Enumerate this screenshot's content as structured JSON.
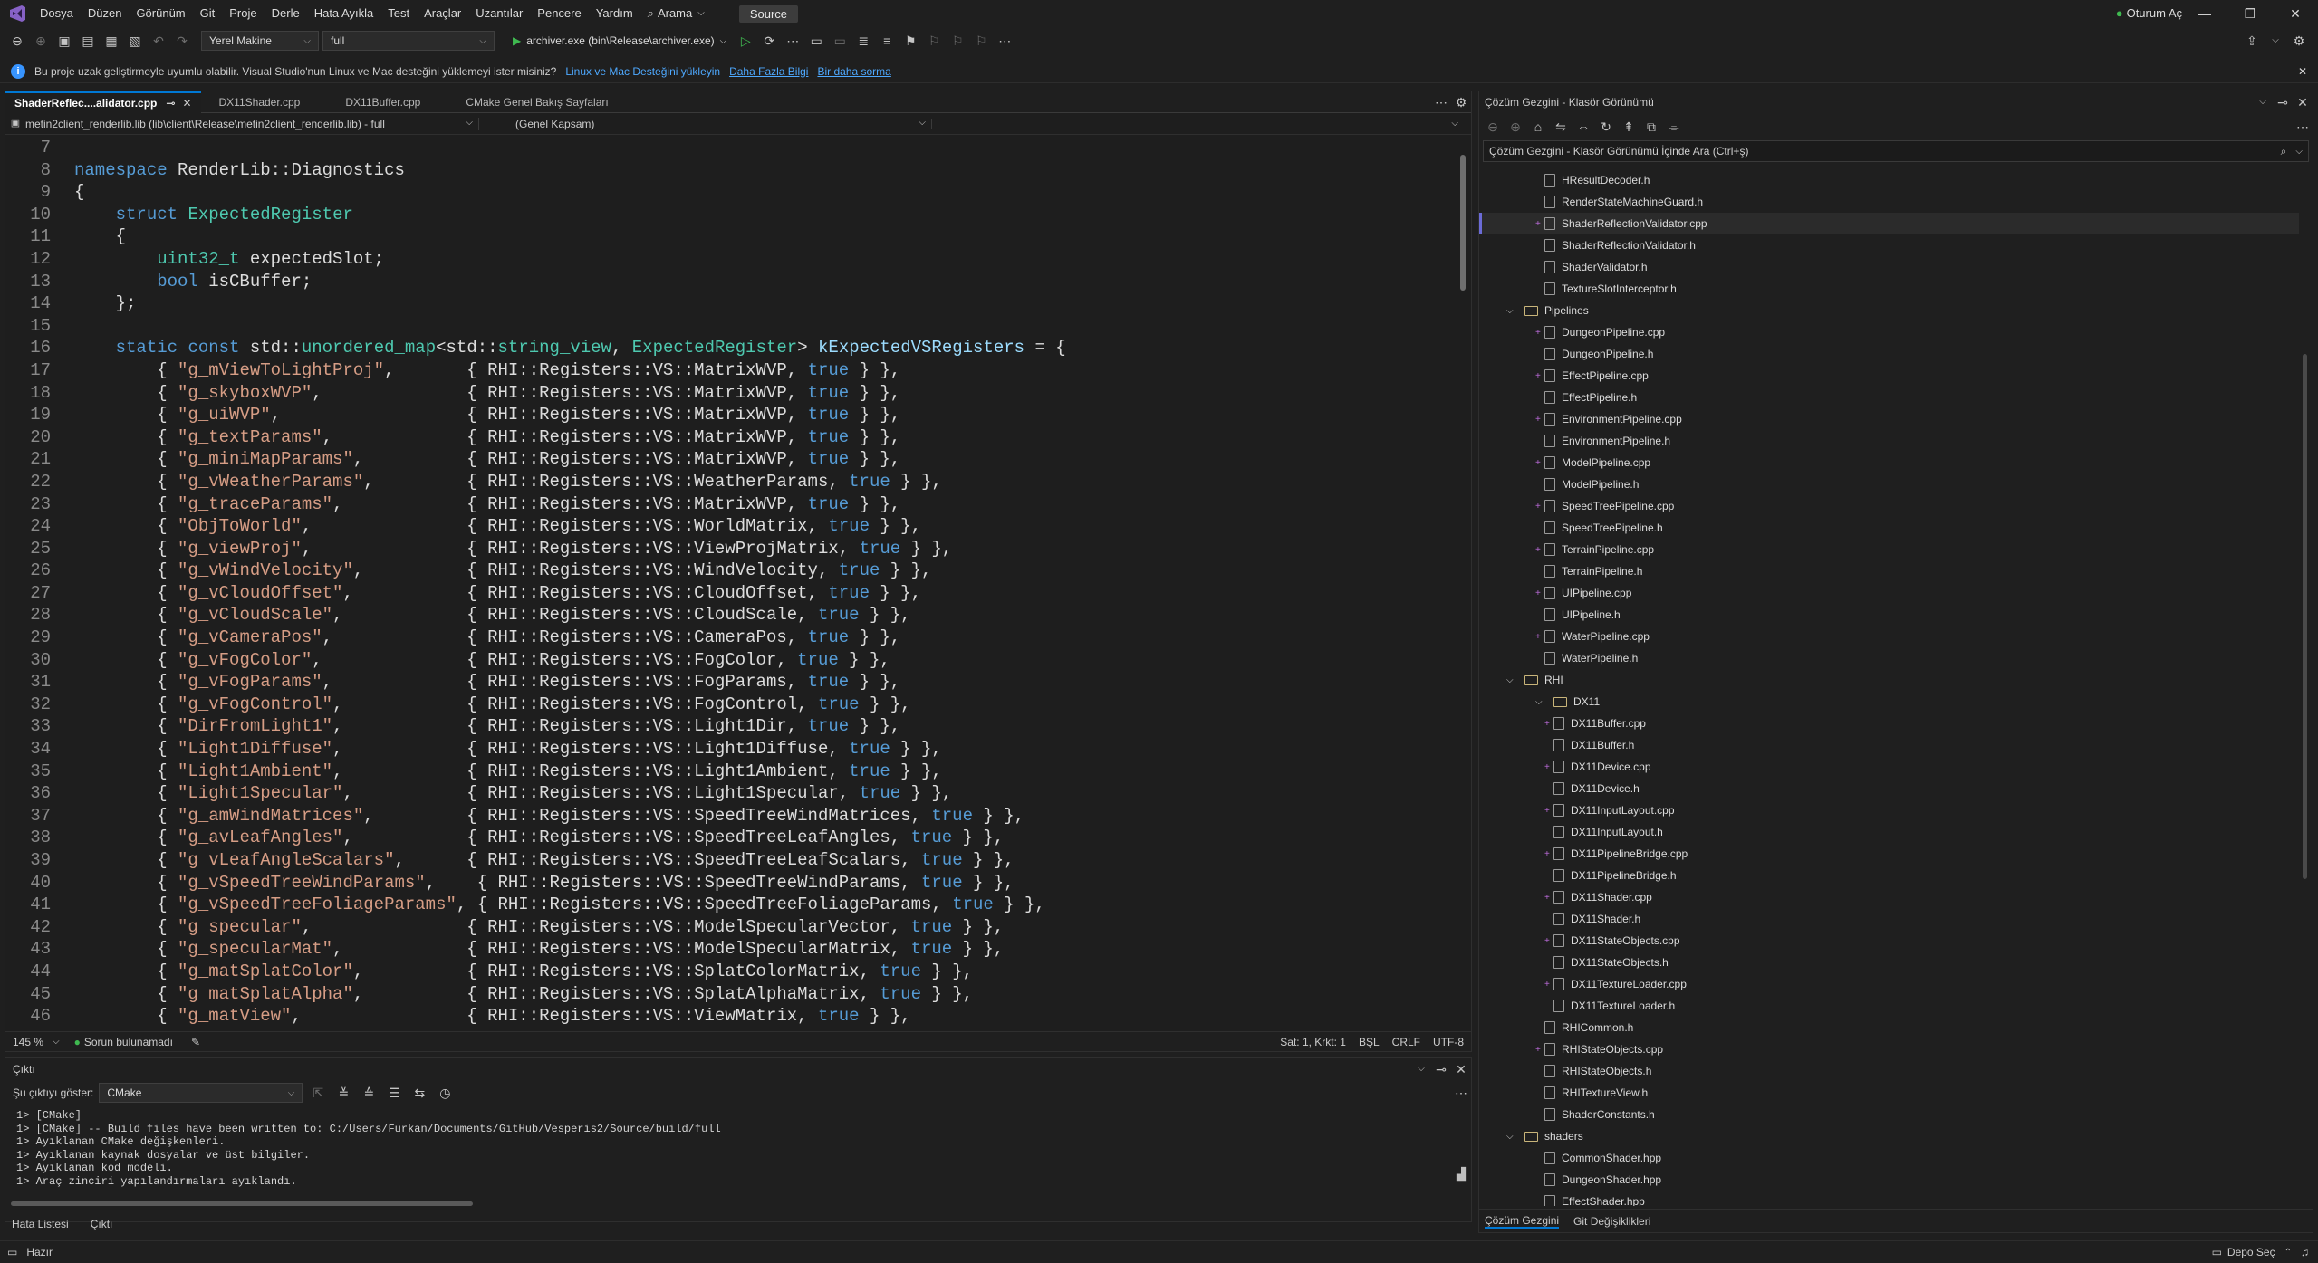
{
  "menubar": {
    "items": [
      "Dosya",
      "Düzen",
      "Görünüm",
      "Git",
      "Proje",
      "Derle",
      "Hata Ayıkla",
      "Test",
      "Araçlar",
      "Uzantılar",
      "Pencere",
      "Yardım"
    ],
    "search_label": "Arama",
    "source_label": "Source",
    "signin_label": "Oturum Aç"
  },
  "toolbar": {
    "machine": "Yerel Makine",
    "config": "full",
    "run_target": "archiver.exe (bin\\Release\\archiver.exe)"
  },
  "infobar": {
    "message": "Bu proje uzak geliştirmeyle uyumlu olabilir. Visual Studio'nun Linux ve Mac desteğini yüklemeyi ister misiniz?",
    "install_link": "Linux ve Mac Desteğini yükleyin",
    "learn_more": "Daha Fazla Bilgi",
    "never_ask": "Bir daha sorma"
  },
  "editor": {
    "tabs": [
      {
        "label": "ShaderReflec....alidator.cpp",
        "active": true
      },
      {
        "label": "DX11Shader.cpp",
        "active": false
      },
      {
        "label": "DX11Buffer.cpp",
        "active": false
      },
      {
        "label": "CMake Genel Bakış Sayfaları",
        "active": false
      }
    ],
    "nav_project": "metin2client_renderlib.lib (lib\\client\\Release\\metin2client_renderlib.lib) - full",
    "nav_scope": "(Genel Kapsam)",
    "zoom": "145 %",
    "issues": "Sorun bulunamadı",
    "position": "Sat: 1, Krkt: 1",
    "whitespace": "BŞL",
    "line_ending": "CRLF",
    "encoding": "UTF-8"
  },
  "code_lines": [
    {
      "n": "7",
      "t": ""
    },
    {
      "n": "8",
      "t": "namespace RenderLib::Diagnostics"
    },
    {
      "n": "9",
      "t": "{"
    },
    {
      "n": "10",
      "t": "    struct ExpectedRegister"
    },
    {
      "n": "11",
      "t": "    {"
    },
    {
      "n": "12",
      "t": "        uint32_t expectedSlot;"
    },
    {
      "n": "13",
      "t": "        bool isCBuffer;"
    },
    {
      "n": "14",
      "t": "    };"
    },
    {
      "n": "15",
      "t": ""
    },
    {
      "n": "16",
      "t": "    static const std::unordered_map<std::string_view, ExpectedRegister> kExpectedVSRegisters = {"
    },
    {
      "n": "17",
      "t": "        { \"g_mViewToLightProj\",       { RHI::Registers::VS::MatrixWVP, true } },"
    },
    {
      "n": "18",
      "t": "        { \"g_skyboxWVP\",              { RHI::Registers::VS::MatrixWVP, true } },"
    },
    {
      "n": "19",
      "t": "        { \"g_uiWVP\",                  { RHI::Registers::VS::MatrixWVP, true } },"
    },
    {
      "n": "20",
      "t": "        { \"g_textParams\",             { RHI::Registers::VS::MatrixWVP, true } },"
    },
    {
      "n": "21",
      "t": "        { \"g_miniMapParams\",          { RHI::Registers::VS::MatrixWVP, true } },"
    },
    {
      "n": "22",
      "t": "        { \"g_vWeatherParams\",         { RHI::Registers::VS::WeatherParams, true } },"
    },
    {
      "n": "23",
      "t": "        { \"g_traceParams\",            { RHI::Registers::VS::MatrixWVP, true } },"
    },
    {
      "n": "24",
      "t": "        { \"ObjToWorld\",               { RHI::Registers::VS::WorldMatrix, true } },"
    },
    {
      "n": "25",
      "t": "        { \"g_viewProj\",               { RHI::Registers::VS::ViewProjMatrix, true } },"
    },
    {
      "n": "26",
      "t": "        { \"g_vWindVelocity\",          { RHI::Registers::VS::WindVelocity, true } },"
    },
    {
      "n": "27",
      "t": "        { \"g_vCloudOffset\",           { RHI::Registers::VS::CloudOffset, true } },"
    },
    {
      "n": "28",
      "t": "        { \"g_vCloudScale\",            { RHI::Registers::VS::CloudScale, true } },"
    },
    {
      "n": "29",
      "t": "        { \"g_vCameraPos\",             { RHI::Registers::VS::CameraPos, true } },"
    },
    {
      "n": "30",
      "t": "        { \"g_vFogColor\",              { RHI::Registers::VS::FogColor, true } },"
    },
    {
      "n": "31",
      "t": "        { \"g_vFogParams\",             { RHI::Registers::VS::FogParams, true } },"
    },
    {
      "n": "32",
      "t": "        { \"g_vFogControl\",            { RHI::Registers::VS::FogControl, true } },"
    },
    {
      "n": "33",
      "t": "        { \"DirFromLight1\",            { RHI::Registers::VS::Light1Dir, true } },"
    },
    {
      "n": "34",
      "t": "        { \"Light1Diffuse\",            { RHI::Registers::VS::Light1Diffuse, true } },"
    },
    {
      "n": "35",
      "t": "        { \"Light1Ambient\",            { RHI::Registers::VS::Light1Ambient, true } },"
    },
    {
      "n": "36",
      "t": "        { \"Light1Specular\",           { RHI::Registers::VS::Light1Specular, true } },"
    },
    {
      "n": "37",
      "t": "        { \"g_amWindMatrices\",         { RHI::Registers::VS::SpeedTreeWindMatrices, true } },"
    },
    {
      "n": "38",
      "t": "        { \"g_avLeafAngles\",           { RHI::Registers::VS::SpeedTreeLeafAngles, true } },"
    },
    {
      "n": "39",
      "t": "        { \"g_vLeafAngleScalars\",      { RHI::Registers::VS::SpeedTreeLeafScalars, true } },"
    },
    {
      "n": "40",
      "t": "        { \"g_vSpeedTreeWindParams\",    { RHI::Registers::VS::SpeedTreeWindParams, true } },"
    },
    {
      "n": "41",
      "t": "        { \"g_vSpeedTreeFoliageParams\", { RHI::Registers::VS::SpeedTreeFoliageParams, true } },"
    },
    {
      "n": "42",
      "t": "        { \"g_specular\",               { RHI::Registers::VS::ModelSpecularVector, true } },"
    },
    {
      "n": "43",
      "t": "        { \"g_specularMat\",            { RHI::Registers::VS::ModelSpecularMatrix, true } },"
    },
    {
      "n": "44",
      "t": "        { \"g_matSplatColor\",          { RHI::Registers::VS::SplatColorMatrix, true } },"
    },
    {
      "n": "45",
      "t": "        { \"g_matSplatAlpha\",          { RHI::Registers::VS::SplatAlphaMatrix, true } },"
    },
    {
      "n": "46",
      "t": "        { \"g_matView\",                { RHI::Registers::VS::ViewMatrix, true } },"
    }
  ],
  "output": {
    "title": "Çıktı",
    "show_label": "Şu çıktıyı göster:",
    "source": "CMake",
    "lines": [
      "1> [CMake]",
      "1> [CMake] -- Build files have been written to: C:/Users/Furkan/Documents/GitHub/Vesperis2/Source/build/full",
      "1> Ayıklanan CMake değişkenleri.",
      "1> Ayıklanan kaynak dosyalar ve üst bilgiler.",
      "1> Ayıklanan kod modeli.",
      "1> Araç zinciri yapılandırmaları ayıklandı."
    ]
  },
  "bottom_tabs": [
    "Hata Listesi",
    "Çıktı"
  ],
  "solution_explorer": {
    "title": "Çözüm Gezgini - Klasör Görünümü",
    "search_placeholder": "Çözüm Gezgini - Klasör Görünümü İçinde Ara (Ctrl+ş)",
    "bottom_tabs": [
      "Çözüm Gezgini",
      "Git Değişiklikleri"
    ],
    "items": [
      {
        "label": "HResultDecoder.h",
        "depth": 0,
        "kind": "file",
        "plus": false,
        "expand": ""
      },
      {
        "label": "RenderStateMachineGuard.h",
        "depth": 0,
        "kind": "file",
        "plus": false,
        "expand": ""
      },
      {
        "label": "ShaderReflectionValidator.cpp",
        "depth": 0,
        "kind": "file",
        "plus": true,
        "expand": "",
        "selected": true
      },
      {
        "label": "ShaderReflectionValidator.h",
        "depth": 0,
        "kind": "file",
        "plus": false,
        "expand": ""
      },
      {
        "label": "ShaderValidator.h",
        "depth": 0,
        "kind": "file",
        "plus": false,
        "expand": ""
      },
      {
        "label": "TextureSlotInterceptor.h",
        "depth": 0,
        "kind": "file",
        "plus": false,
        "expand": ""
      },
      {
        "label": "Pipelines",
        "depth": -1,
        "kind": "folder",
        "plus": false,
        "expand": "⌵"
      },
      {
        "label": "DungeonPipeline.cpp",
        "depth": 0,
        "kind": "file",
        "plus": true,
        "expand": ""
      },
      {
        "label": "DungeonPipeline.h",
        "depth": 0,
        "kind": "file",
        "plus": false,
        "expand": ""
      },
      {
        "label": "EffectPipeline.cpp",
        "depth": 0,
        "kind": "file",
        "plus": true,
        "expand": ""
      },
      {
        "label": "EffectPipeline.h",
        "depth": 0,
        "kind": "file",
        "plus": false,
        "expand": ""
      },
      {
        "label": "EnvironmentPipeline.cpp",
        "depth": 0,
        "kind": "file",
        "plus": true,
        "expand": ""
      },
      {
        "label": "EnvironmentPipeline.h",
        "depth": 0,
        "kind": "file",
        "plus": false,
        "expand": ""
      },
      {
        "label": "ModelPipeline.cpp",
        "depth": 0,
        "kind": "file",
        "plus": true,
        "expand": ""
      },
      {
        "label": "ModelPipeline.h",
        "depth": 0,
        "kind": "file",
        "plus": false,
        "expand": ""
      },
      {
        "label": "SpeedTreePipeline.cpp",
        "depth": 0,
        "kind": "file",
        "plus": true,
        "expand": ""
      },
      {
        "label": "SpeedTreePipeline.h",
        "depth": 0,
        "kind": "file",
        "plus": false,
        "expand": ""
      },
      {
        "label": "TerrainPipeline.cpp",
        "depth": 0,
        "kind": "file",
        "plus": true,
        "expand": ""
      },
      {
        "label": "TerrainPipeline.h",
        "depth": 0,
        "kind": "file",
        "plus": false,
        "expand": ""
      },
      {
        "label": "UIPipeline.cpp",
        "depth": 0,
        "kind": "file",
        "plus": true,
        "expand": ""
      },
      {
        "label": "UIPipeline.h",
        "depth": 0,
        "kind": "file",
        "plus": false,
        "expand": ""
      },
      {
        "label": "WaterPipeline.cpp",
        "depth": 0,
        "kind": "file",
        "plus": true,
        "expand": ""
      },
      {
        "label": "WaterPipeline.h",
        "depth": 0,
        "kind": "file",
        "plus": false,
        "expand": ""
      },
      {
        "label": "RHI",
        "depth": -1,
        "kind": "folder",
        "plus": false,
        "expand": "⌵"
      },
      {
        "label": "DX11",
        "depth": 0,
        "kind": "folder",
        "plus": false,
        "expand": "⌵"
      },
      {
        "label": "DX11Buffer.cpp",
        "depth": 1,
        "kind": "file",
        "plus": true,
        "expand": ""
      },
      {
        "label": "DX11Buffer.h",
        "depth": 1,
        "kind": "file",
        "plus": false,
        "expand": ""
      },
      {
        "label": "DX11Device.cpp",
        "depth": 1,
        "kind": "file",
        "plus": true,
        "expand": ""
      },
      {
        "label": "DX11Device.h",
        "depth": 1,
        "kind": "file",
        "plus": false,
        "expand": ""
      },
      {
        "label": "DX11InputLayout.cpp",
        "depth": 1,
        "kind": "file",
        "plus": true,
        "expand": ""
      },
      {
        "label": "DX11InputLayout.h",
        "depth": 1,
        "kind": "file",
        "plus": false,
        "expand": ""
      },
      {
        "label": "DX11PipelineBridge.cpp",
        "depth": 1,
        "kind": "file",
        "plus": true,
        "expand": ""
      },
      {
        "label": "DX11PipelineBridge.h",
        "depth": 1,
        "kind": "file",
        "plus": false,
        "expand": ""
      },
      {
        "label": "DX11Shader.cpp",
        "depth": 1,
        "kind": "file",
        "plus": true,
        "expand": ""
      },
      {
        "label": "DX11Shader.h",
        "depth": 1,
        "kind": "file",
        "plus": false,
        "expand": ""
      },
      {
        "label": "DX11StateObjects.cpp",
        "depth": 1,
        "kind": "file",
        "plus": true,
        "expand": ""
      },
      {
        "label": "DX11StateObjects.h",
        "depth": 1,
        "kind": "file",
        "plus": false,
        "expand": ""
      },
      {
        "label": "DX11TextureLoader.cpp",
        "depth": 1,
        "kind": "file",
        "plus": true,
        "expand": ""
      },
      {
        "label": "DX11TextureLoader.h",
        "depth": 1,
        "kind": "file",
        "plus": false,
        "expand": ""
      },
      {
        "label": "RHICommon.h",
        "depth": 0,
        "kind": "file",
        "plus": false,
        "expand": ""
      },
      {
        "label": "RHIStateObjects.cpp",
        "depth": 0,
        "kind": "file",
        "plus": true,
        "expand": ""
      },
      {
        "label": "RHIStateObjects.h",
        "depth": 0,
        "kind": "file",
        "plus": false,
        "expand": ""
      },
      {
        "label": "RHITextureView.h",
        "depth": 0,
        "kind": "file",
        "plus": false,
        "expand": ""
      },
      {
        "label": "ShaderConstants.h",
        "depth": 0,
        "kind": "file",
        "plus": false,
        "expand": ""
      },
      {
        "label": "shaders",
        "depth": -1,
        "kind": "folder",
        "plus": false,
        "expand": "⌵"
      },
      {
        "label": "CommonShader.hpp",
        "depth": 0,
        "kind": "file",
        "plus": false,
        "expand": ""
      },
      {
        "label": "DungeonShader.hpp",
        "depth": 0,
        "kind": "file",
        "plus": false,
        "expand": ""
      },
      {
        "label": "EffectShader.hpp",
        "depth": 0,
        "kind": "file",
        "plus": false,
        "expand": ""
      }
    ]
  },
  "statusbar": {
    "ready": "Hazır",
    "repo_select": "Depo Seç"
  },
  "colors": {
    "accent": "#0078d4",
    "keyword": "#569cd6",
    "type": "#4ec9b0",
    "string": "#d69d85",
    "link": "#4ea9ff",
    "ok": "#3fb950"
  }
}
